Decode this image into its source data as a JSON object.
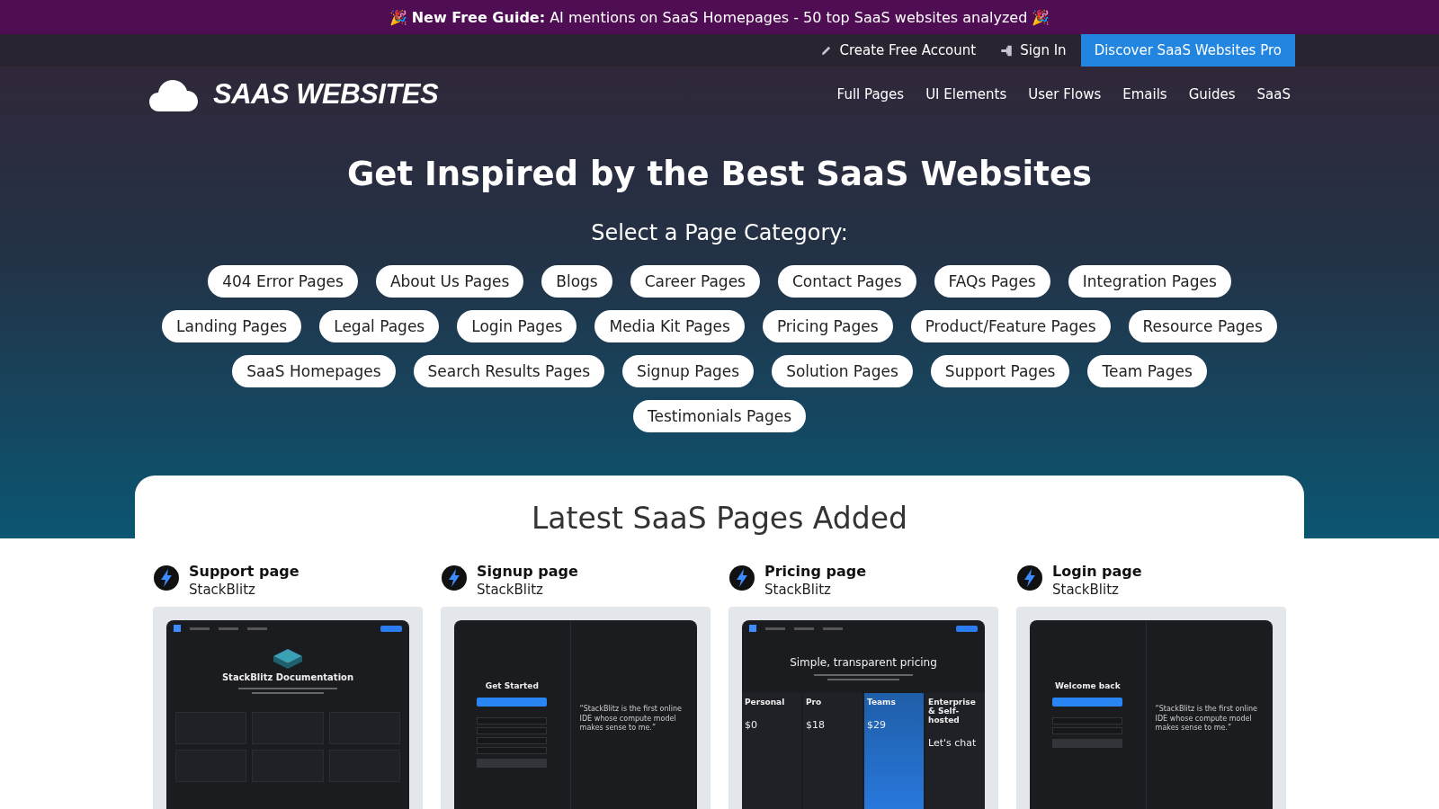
{
  "announcement": {
    "text": "🎉 **New Free Guide:** AI mentions on SaaS Homepages - 50 top SaaS websites analyzed 🎉"
  },
  "top_links": [
    {
      "kind": "create",
      "label": "Create Free Account"
    },
    {
      "kind": "signin",
      "label": "Sign In"
    },
    {
      "kind": "pro",
      "label": "Discover SaaS Websites Pro"
    }
  ],
  "logo": {
    "text": "SAAS WEBSITES"
  },
  "nav": [
    "Full Pages",
    "UI Elements",
    "User Flows",
    "Emails",
    "Guides",
    "SaaS"
  ],
  "hero": {
    "title": "Get Inspired by the Best SaaS Websites",
    "subtitle": "Select a Page Category:"
  },
  "categories": [
    "404 Error Pages",
    "About Us Pages",
    "Blogs",
    "Career Pages",
    "Contact Pages",
    "FAQs Pages",
    "Integration Pages",
    "Landing Pages",
    "Legal Pages",
    "Login Pages",
    "Media Kit Pages",
    "Pricing Pages",
    "Product/Feature Pages",
    "Resource Pages",
    "SaaS Homepages",
    "Search Results Pages",
    "Signup Pages",
    "Solution Pages",
    "Support Pages",
    "Team Pages",
    "Testimonials Pages"
  ],
  "latest": {
    "title": "Latest SaaS Pages Added",
    "items": [
      {
        "title": "Support page",
        "company": "StackBlitz",
        "preview": {
          "kind": "docs",
          "heading": "StackBlitz Documentation"
        }
      },
      {
        "title": "Signup page",
        "company": "StackBlitz",
        "preview": {
          "kind": "signup",
          "heading": "Get Started",
          "quote": "“StackBlitz is the first online IDE whose compute model makes sense to me.”"
        }
      },
      {
        "title": "Pricing page",
        "company": "StackBlitz",
        "preview": {
          "kind": "pricing",
          "heading": "Simple, transparent pricing",
          "plans": [
            {
              "name": "Personal",
              "price": "$0"
            },
            {
              "name": "Pro",
              "price": "$18"
            },
            {
              "name": "Teams",
              "price": "$29"
            },
            {
              "name": "Enterprise & Self-hosted",
              "price": "Let's chat"
            }
          ]
        }
      },
      {
        "title": "Login page",
        "company": "StackBlitz",
        "preview": {
          "kind": "login",
          "heading": "Welcome back",
          "quote": "“StackBlitz is the first online IDE whose compute model makes sense to me.”"
        }
      }
    ]
  }
}
